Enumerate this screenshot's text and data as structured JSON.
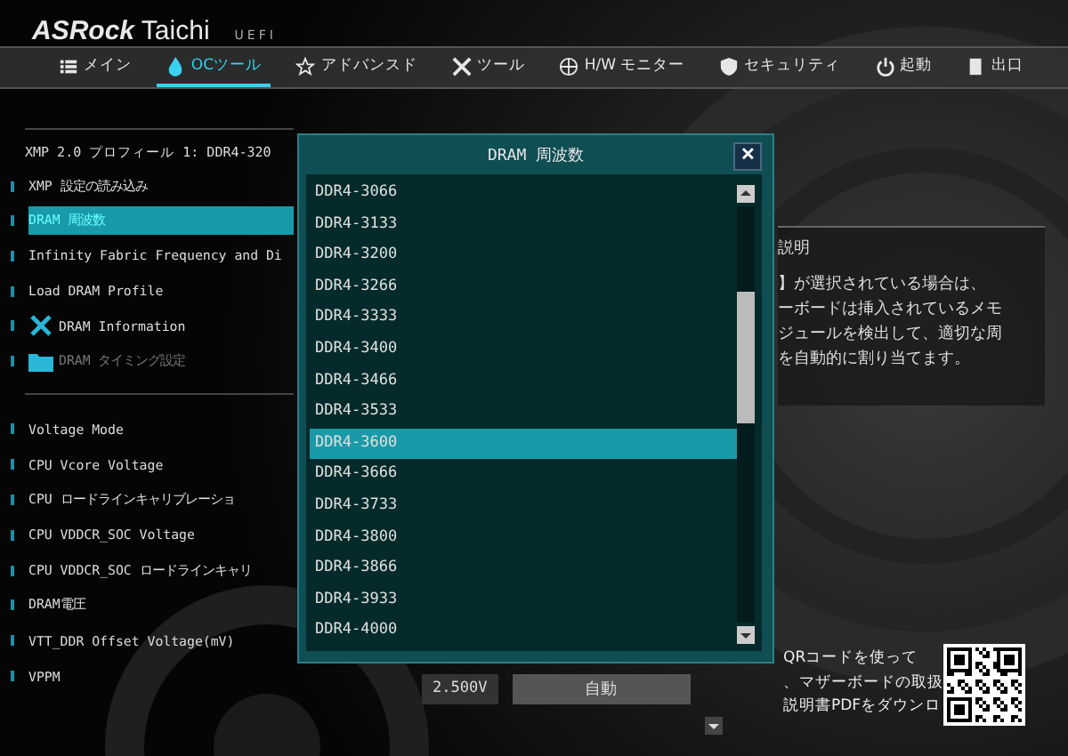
{
  "header": {
    "logo": "ASRock",
    "product": "Taichi",
    "badge": "UEFI"
  },
  "tabs": [
    {
      "label": "メイン",
      "selected": false
    },
    {
      "label": "OCツール",
      "selected": true
    },
    {
      "label": "アドバンスド",
      "selected": false
    },
    {
      "label": "ツール",
      "selected": false
    },
    {
      "label": "H/W モニター",
      "selected": false
    },
    {
      "label": "セキュリティ",
      "selected": false
    },
    {
      "label": "起動",
      "selected": false
    },
    {
      "label": "出口",
      "selected": false
    }
  ],
  "settings_top": {
    "info": "XMP 2.0 プロフィール 1: DDR4-320",
    "items": [
      {
        "label": "XMP 設定の読み込み",
        "kind": "item",
        "selected": false,
        "disabled": false
      },
      {
        "label": "DRAM 周波数",
        "kind": "item",
        "selected": true,
        "disabled": false
      },
      {
        "label": "Infinity Fabric Frequency and Di",
        "kind": "item",
        "selected": false,
        "disabled": false
      },
      {
        "label": "Load DRAM Profile",
        "kind": "item",
        "selected": false,
        "disabled": false
      },
      {
        "label": "DRAM Information",
        "kind": "wrench",
        "selected": false,
        "disabled": false
      },
      {
        "label": "DRAM タイミング設定",
        "kind": "folder",
        "selected": false,
        "disabled": true
      }
    ]
  },
  "settings_voltage": [
    {
      "label": "Voltage Mode"
    },
    {
      "label": "CPU Vcore Voltage"
    },
    {
      "label": "CPU ロードラインキャリブレーショ"
    },
    {
      "label": "CPU VDDCR_SOC Voltage"
    },
    {
      "label": "CPU VDDCR_SOC ロードラインキャリ"
    },
    {
      "label": "DRAM電圧"
    },
    {
      "label": "VTT_DDR Offset Voltage(mV)"
    },
    {
      "label": "VPPM",
      "reading": "2.500V",
      "value": "自動"
    }
  ],
  "description": {
    "title": "説明",
    "lines": [
      "】が選択されている場合は、",
      "ーボードは挿入されているメモ",
      "ジュールを検出して、適切な周",
      "を自動的に割り当てます。"
    ]
  },
  "qr_note": {
    "lines": [
      "QRコードを使って",
      "、マザーボードの取扱",
      "説明書PDFをダウンロ"
    ]
  },
  "dialog": {
    "title": "DRAM 周波数",
    "close": "✕",
    "options": [
      {
        "label": "DDR4-3066",
        "selected": false
      },
      {
        "label": "DDR4-3133",
        "selected": false
      },
      {
        "label": "DDR4-3200",
        "selected": false
      },
      {
        "label": "DDR4-3266",
        "selected": false
      },
      {
        "label": "DDR4-3333",
        "selected": false
      },
      {
        "label": "DDR4-3400",
        "selected": false
      },
      {
        "label": "DDR4-3466",
        "selected": false
      },
      {
        "label": "DDR4-3533",
        "selected": false
      },
      {
        "label": "DDR4-3600",
        "selected": true
      },
      {
        "label": "DDR4-3666",
        "selected": false
      },
      {
        "label": "DDR4-3733",
        "selected": false
      },
      {
        "label": "DDR4-3800",
        "selected": false
      },
      {
        "label": "DDR4-3866",
        "selected": false
      },
      {
        "label": "DDR4-3933",
        "selected": false
      },
      {
        "label": "DDR4-4000",
        "selected": false
      }
    ]
  }
}
